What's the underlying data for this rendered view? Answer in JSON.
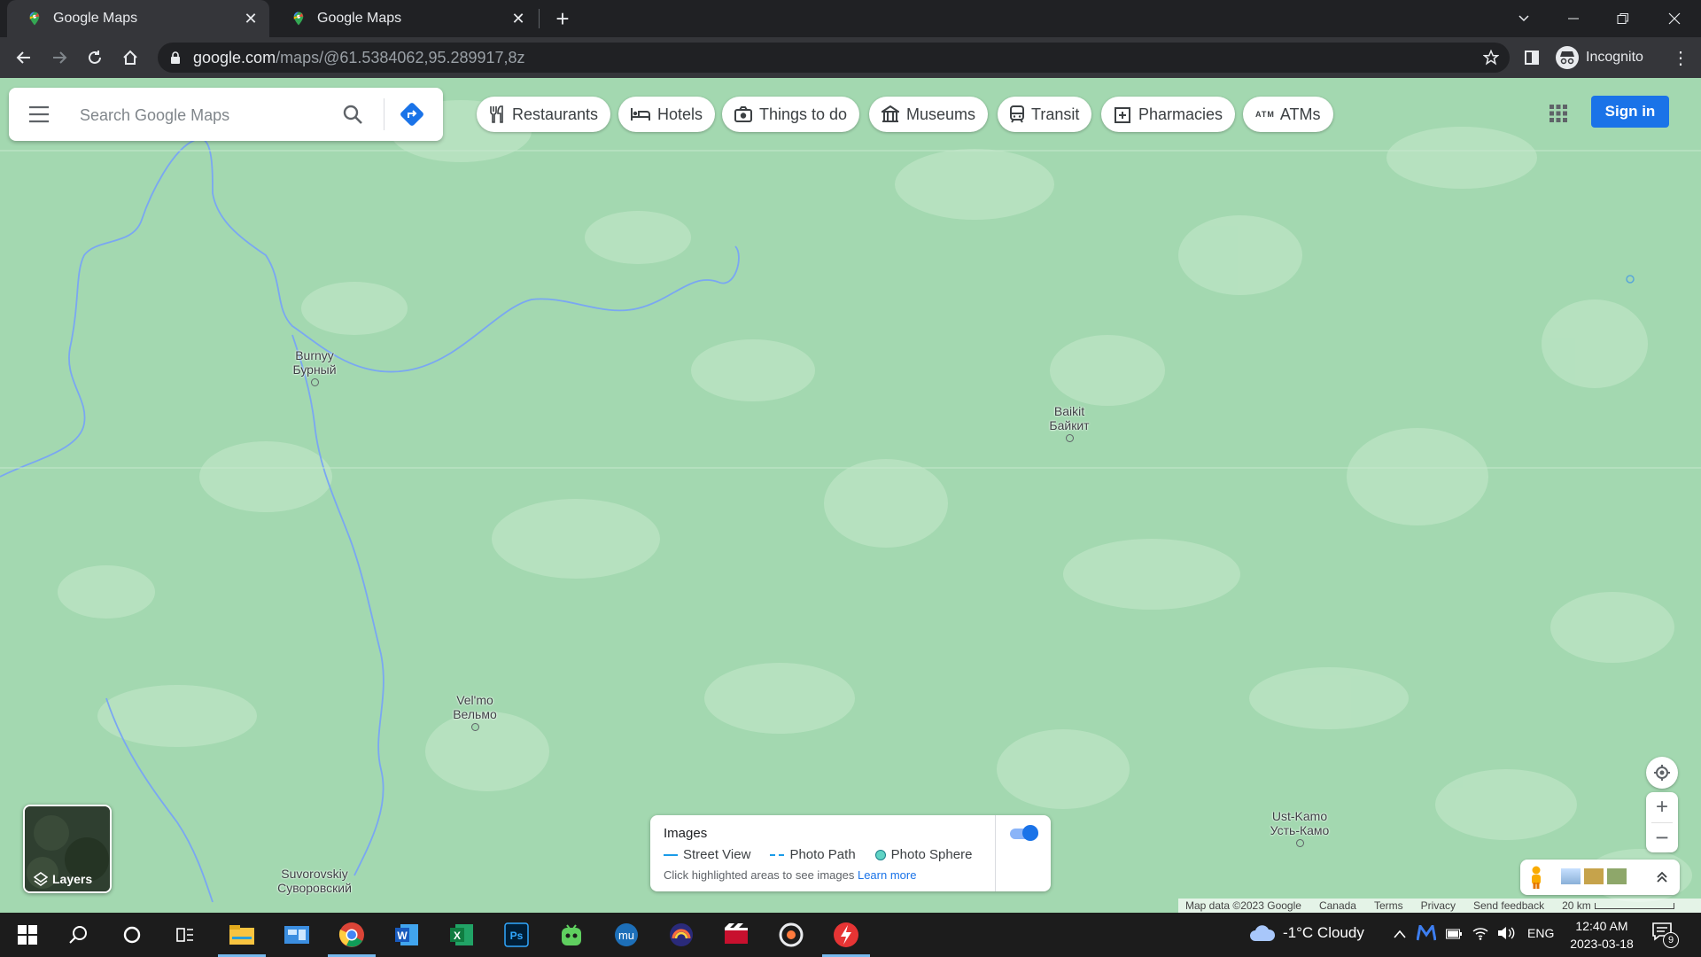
{
  "browser": {
    "tabs": [
      {
        "title": "Google Maps",
        "active": true
      },
      {
        "title": "Google Maps",
        "active": false
      }
    ],
    "url": {
      "host": "google.com",
      "path": "/maps/@61.5384062,95.289917,8z"
    },
    "profile_label": "Incognito"
  },
  "maps": {
    "search_placeholder": "Search Google Maps",
    "chips": [
      "Restaurants",
      "Hotels",
      "Things to do",
      "Museums",
      "Transit",
      "Pharmacies",
      "ATMs"
    ],
    "sign_in_label": "Sign in",
    "places": [
      {
        "name": "Burnyy",
        "native": "Бурный"
      },
      {
        "name": "Baikit",
        "native": "Байкит"
      },
      {
        "name": "Vel'mo",
        "native": "Вельмо"
      },
      {
        "name": "Suvorovskiy",
        "native": "Суворовский"
      },
      {
        "name": "Ust-Kamo",
        "native": "Усть-Камо"
      }
    ],
    "layers_label": "Layers",
    "images_panel": {
      "title": "Images",
      "legend": [
        "Street View",
        "Photo Path",
        "Photo Sphere"
      ],
      "hint": "Click highlighted areas to see images",
      "learn_more": "Learn more",
      "toggle_on": true
    },
    "footer": {
      "map_data": "Map data ©2023 Google",
      "country": "Canada",
      "terms": "Terms",
      "privacy": "Privacy",
      "feedback": "Send feedback",
      "scale": "20 km"
    },
    "colors": {
      "land": "#a3d8b0",
      "forest_patch": "#b9e2c2",
      "water": "#7aa7f2",
      "accent": "#1a73e8"
    }
  },
  "taskbar": {
    "weather": "-1°C  Cloudy",
    "language": "ENG",
    "time": "12:40 AM",
    "date": "2023-03-18",
    "notification_count": "9"
  }
}
